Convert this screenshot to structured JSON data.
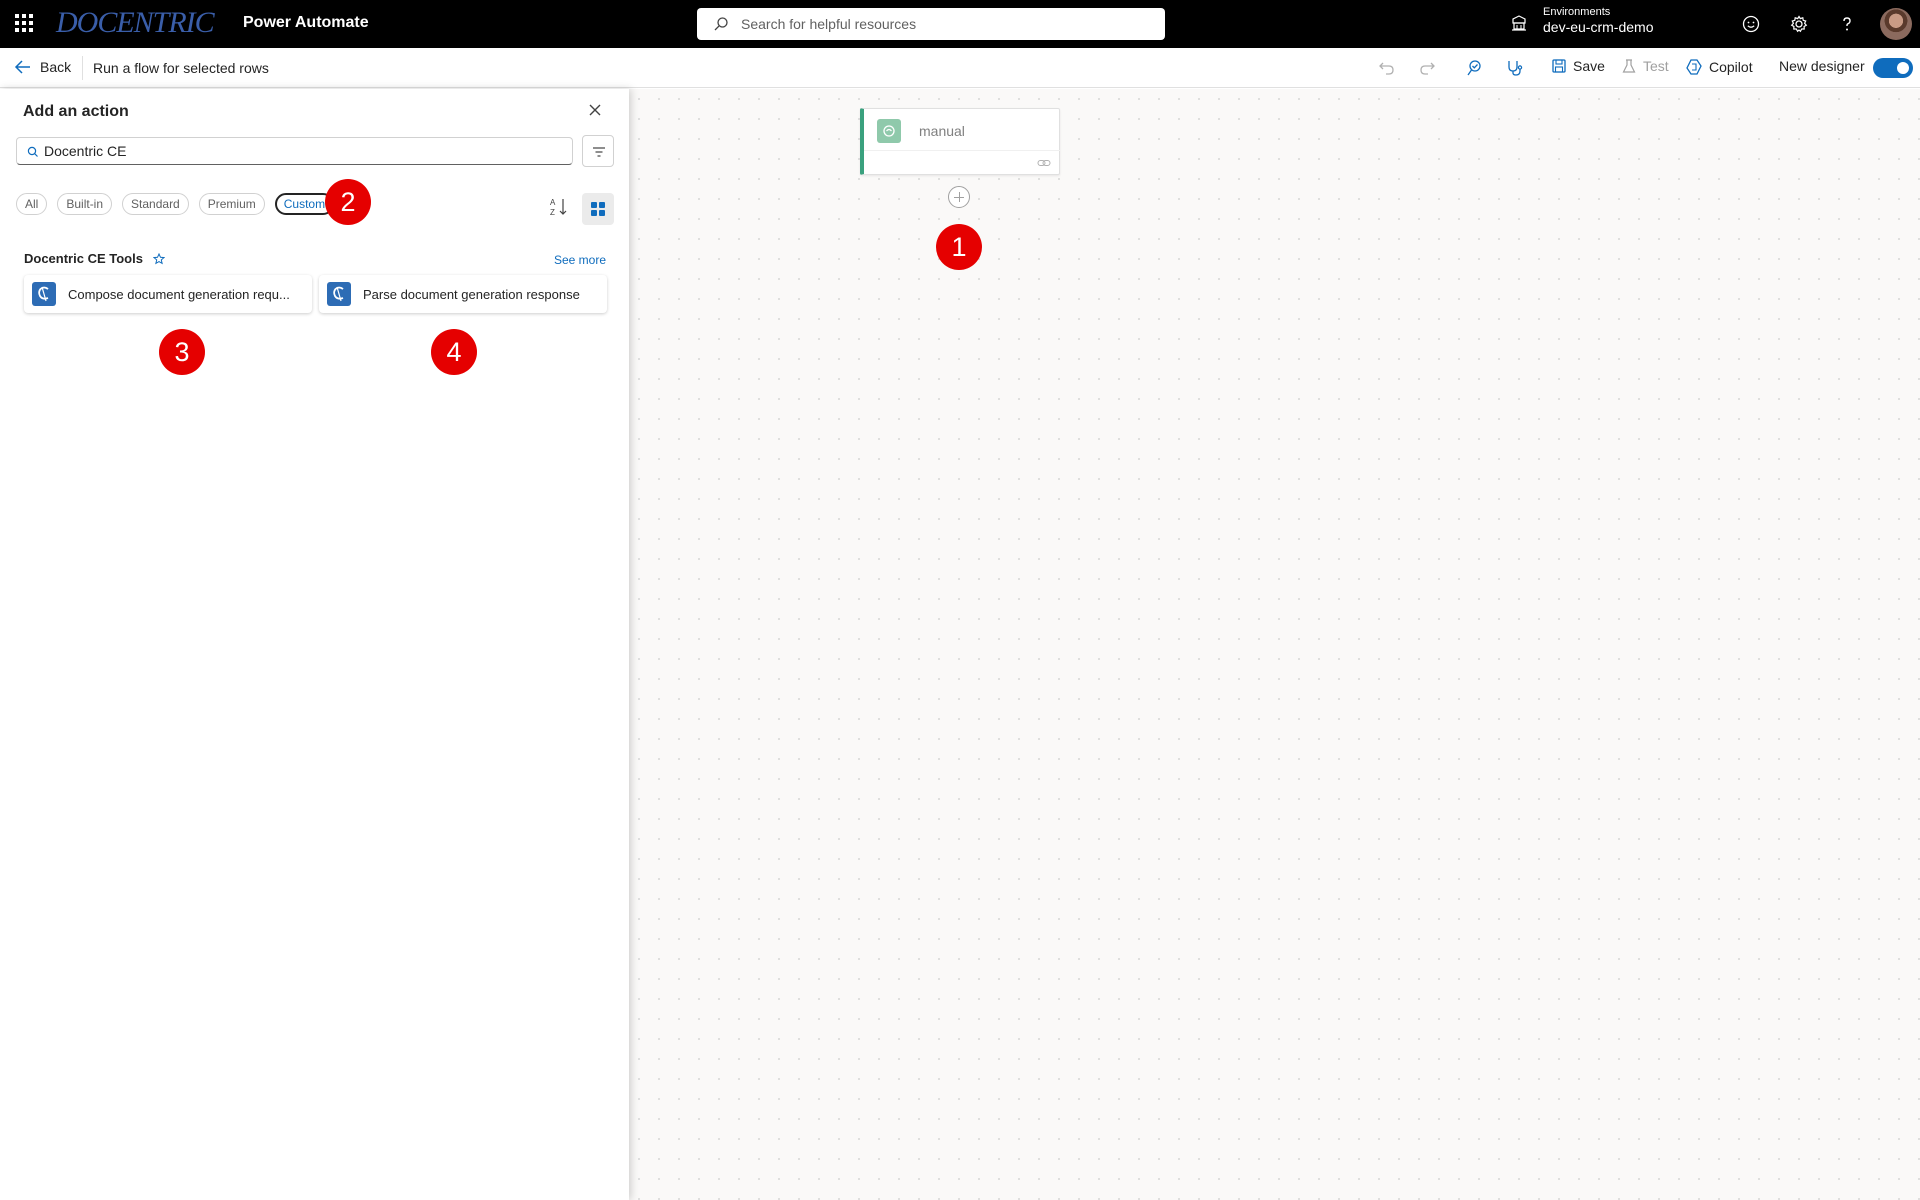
{
  "header": {
    "logo_text": "DOCENTRIC",
    "app_name": "Power Automate",
    "search_placeholder": "Search for helpful resources",
    "environment_label": "Environments",
    "environment_name": "dev-eu-crm-demo"
  },
  "commandbar": {
    "back_label": "Back",
    "flow_title": "Run a flow for selected rows",
    "save_label": "Save",
    "test_label": "Test",
    "copilot_label": "Copilot",
    "new_designer_label": "New designer",
    "new_designer_enabled": true
  },
  "panel": {
    "title": "Add an action",
    "search_value": "Docentric CE",
    "filters": [
      {
        "label": "All",
        "active": false
      },
      {
        "label": "Built-in",
        "active": false
      },
      {
        "label": "Standard",
        "active": false
      },
      {
        "label": "Premium",
        "active": false
      },
      {
        "label": "Custom",
        "active": true
      }
    ],
    "section_title": "Docentric CE Tools",
    "see_more": "See more",
    "actions": [
      {
        "label": "Compose document generation requ..."
      },
      {
        "label": "Parse document generation response"
      }
    ]
  },
  "canvas": {
    "trigger_label": "manual"
  },
  "callouts": [
    "1",
    "2",
    "3",
    "4"
  ],
  "colors": {
    "accent": "#0f6cbd",
    "callout": "#e50000",
    "trigger_border": "#3aa17e",
    "connector_icon": "#2d6cb5"
  }
}
